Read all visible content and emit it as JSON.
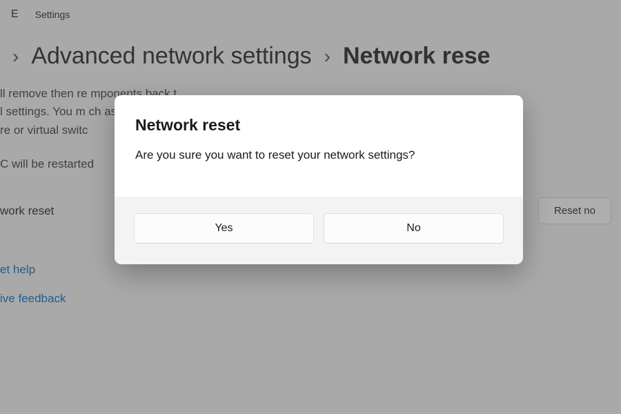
{
  "titlebar": {
    "app_icon_glyph": "E",
    "app_name": "Settings"
  },
  "breadcrumb": {
    "item1": "Advanced network settings",
    "item2": "Network rese"
  },
  "page": {
    "desc_line1": "ll remove then re                                                                                                  mponents back t",
    "desc_line2": "l settings. You m                                                                                                   ch as VPN client",
    "desc_line3": "re or virtual switc",
    "restart_note": "C will be restarted",
    "reset_row_label": "work reset",
    "reset_button_label": "Reset no"
  },
  "links": {
    "help": "et help",
    "feedback": "ive feedback"
  },
  "dialog": {
    "title": "Network reset",
    "message": "Are you sure you want to reset your network settings?",
    "yes_label": "Yes",
    "no_label": "No"
  }
}
